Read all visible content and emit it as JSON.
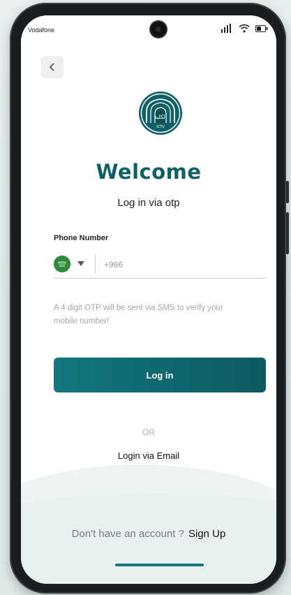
{
  "status_bar": {
    "carrier": "Vodafone"
  },
  "header": {
    "back_icon": "chevron-left-icon"
  },
  "brand": {
    "logo_text": "ﺍﻟﻜﻠﻴﺔ",
    "logo_subtext": "ICTV",
    "color": "#0e5f68"
  },
  "main": {
    "title": "Welcome",
    "subtitle": "Log in via otp",
    "phone_label": "Phone Number",
    "country_flag": "saudi-flag-icon",
    "phone_placeholder": "+966",
    "hint": "A 4 digit OTP will be sent via SMS to verify your mobile number!",
    "login_label": "Log in",
    "or_label": "OR",
    "email_link": "Login via Email"
  },
  "footer": {
    "signup_question": "Don't have an account ?",
    "signup_link": "Sign Up"
  },
  "colors": {
    "accent": "#14767e",
    "accent_dark": "#0c5a62",
    "hint": "#a3a9ac"
  }
}
